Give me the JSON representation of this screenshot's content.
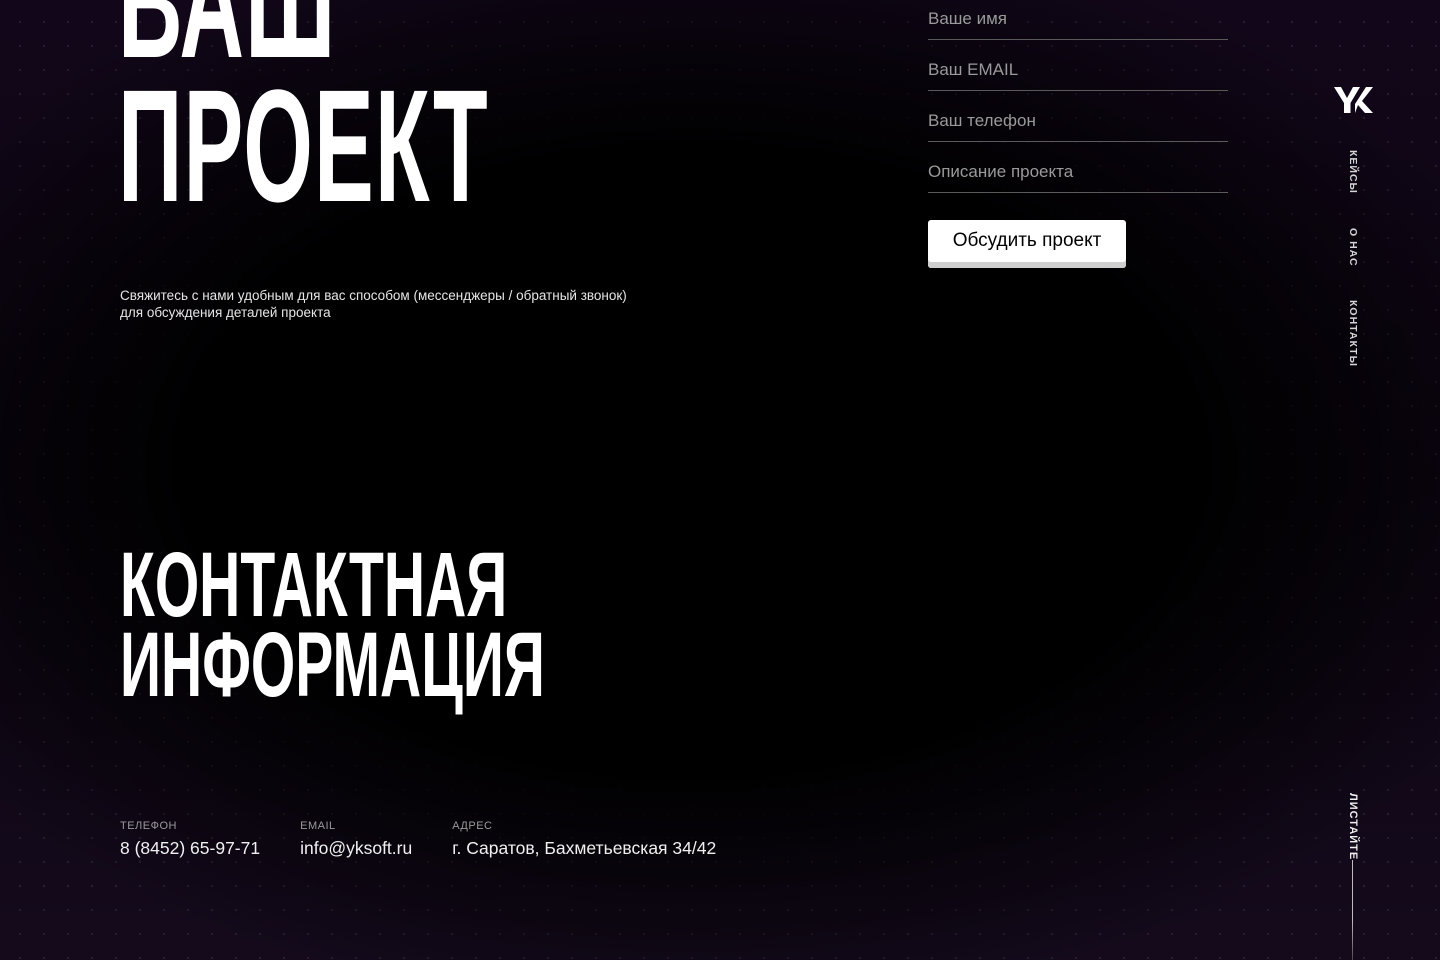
{
  "hero": {
    "title_line1": "ВАШ",
    "title_line2": "ПРОЕКТ",
    "subtitle": "Свяжитесь с нами удобным для вас способом (мессенджеры / обратный звонок) для обсуждения деталей проекта"
  },
  "form": {
    "name_placeholder": "Ваше имя",
    "email_placeholder": "Ваш EMAIL",
    "phone_placeholder": "Ваш телефон",
    "description_placeholder": "Описание проекта",
    "submit_label": "Обсудить проект"
  },
  "contact_section": {
    "title_line1": "КОНТАКТНАЯ",
    "title_line2": "ИНФОРМАЦИЯ",
    "phone_label": "ТЕЛЕФОН",
    "phone_value": "8 (8452) 65-97-71",
    "email_label": "EMAIL",
    "email_value": "info@yksoft.ru",
    "address_label": "АДРЕС",
    "address_value": "г. Саратов, Бахметьевская 34/42"
  },
  "nav": {
    "logo": "YK",
    "items": [
      {
        "label": "КЕЙСЫ"
      },
      {
        "label": "О НАС"
      },
      {
        "label": "КОНТАКТЫ"
      }
    ],
    "scroll_label": "ЛИСТАЙТЕ"
  },
  "colors": {
    "background": "#000000",
    "text": "#ffffff",
    "muted": "#9a9a9a",
    "button_bg": "#ffffff"
  }
}
